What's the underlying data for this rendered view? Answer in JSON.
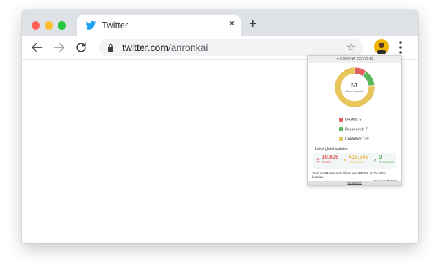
{
  "tab": {
    "title": "Twitter",
    "close_glyph": "×",
    "new_tab_glyph": "+"
  },
  "omnibox": {
    "host": "twitter.com",
    "path": "/anronkai",
    "star_glyph": "☆"
  },
  "popup": {
    "header": "CORONA: COVID-19",
    "header_icon": "virus-icon",
    "total_cases": "51",
    "cases_label": "Cases reported",
    "legend": [
      {
        "label": "Deaths: 5",
        "color": "#e06060"
      },
      {
        "label": "Recovered: 7",
        "color": "#5cb85c"
      },
      {
        "label": "Confirmed: 39",
        "color": "#e8c55a"
      }
    ],
    "chart_data": {
      "type": "pie",
      "categories": [
        "Deaths",
        "Recovered",
        "Confirmed"
      ],
      "values": [
        5,
        7,
        39
      ],
      "colors": [
        "#e06060",
        "#5cb85c",
        "#e8c55a"
      ]
    },
    "updates_title": "Latest global updates",
    "stats": {
      "deaths_num": "18,825",
      "deaths_lbl": "Deaths",
      "deaths_color": "#e06060",
      "confirmed_num": "418,045",
      "confirmed_lbl": "Confirmed",
      "confirmed_color": "#e8b84a",
      "recovered_num": "0",
      "recovered_lbl": "Recovered",
      "recovered_color": "#4caf50"
    },
    "total_text": "Total 81661 cases on China and 337087 on the other location.",
    "date_text": "Tue Mar 24 2020",
    "footer": "Bangladesh"
  }
}
